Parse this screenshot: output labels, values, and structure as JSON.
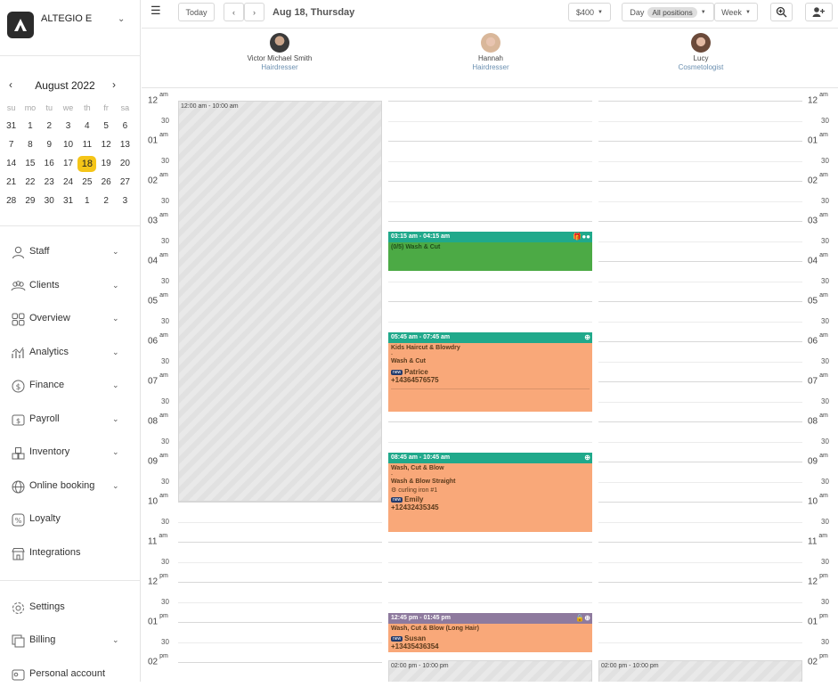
{
  "brand": {
    "name": "ALTEGIO E"
  },
  "calendar": {
    "month": "August 2022",
    "weekdays": [
      "su",
      "mo",
      "tu",
      "we",
      "th",
      "fr",
      "sa"
    ],
    "weeks": [
      [
        "31",
        "1",
        "2",
        "3",
        "4",
        "5",
        "6"
      ],
      [
        "7",
        "8",
        "9",
        "10",
        "11",
        "12",
        "13"
      ],
      [
        "14",
        "15",
        "16",
        "17",
        "18",
        "19",
        "20"
      ],
      [
        "21",
        "22",
        "23",
        "24",
        "25",
        "26",
        "27"
      ],
      [
        "28",
        "29",
        "30",
        "31",
        "1",
        "2",
        "3"
      ]
    ],
    "selected": "18"
  },
  "nav": {
    "staff": "Staff",
    "clients": "Clients",
    "overview": "Overview",
    "analytics": "Analytics",
    "finance": "Finance",
    "payroll": "Payroll",
    "inventory": "Inventory",
    "online_booking": "Online booking",
    "loyalty": "Loyalty",
    "integrations": "Integrations",
    "settings": "Settings",
    "billing": "Billing",
    "personal_account": "Personal account"
  },
  "toolbar": {
    "today": "Today",
    "date": "Aug 18, Thursday",
    "amount": "$400",
    "day": "Day",
    "positions": "All positions",
    "week": "Week"
  },
  "staff": [
    {
      "name": "Victor Michael Smith",
      "role": "Hairdresser"
    },
    {
      "name": "Hannah",
      "role": "Hairdresser"
    },
    {
      "name": "Lucy",
      "role": "Cosmetologist"
    }
  ],
  "timeline": {
    "hours": [
      {
        "h": "12",
        "ap": "am"
      },
      {
        "h": "01",
        "ap": "am"
      },
      {
        "h": "02",
        "ap": "am"
      },
      {
        "h": "03",
        "ap": "am"
      },
      {
        "h": "04",
        "ap": "am"
      },
      {
        "h": "05",
        "ap": "am"
      },
      {
        "h": "06",
        "ap": "am"
      },
      {
        "h": "07",
        "ap": "am"
      },
      {
        "h": "08",
        "ap": "am"
      },
      {
        "h": "09",
        "ap": "am"
      },
      {
        "h": "10",
        "ap": "am"
      },
      {
        "h": "11",
        "ap": "am"
      },
      {
        "h": "12",
        "ap": "pm"
      },
      {
        "h": "01",
        "ap": "pm"
      },
      {
        "h": "02",
        "ap": "pm"
      }
    ],
    "half_label": "30"
  },
  "blocks": {
    "victor_morning": "12:00 am - 10:00 am",
    "hannah_afternoon": "02:00 pm - 10:00 pm",
    "lucy_afternoon": "02:00 pm - 10:00 pm"
  },
  "appointments": {
    "a1": {
      "time": "03:15 am - 04:15 am",
      "service": "(0/5) Wash & Cut",
      "colors": {
        "head": "#20a98b",
        "body": "#4caa45"
      }
    },
    "a2": {
      "time": "05:45 am - 07:45 am",
      "service1": "Kids Haircut & Blowdry",
      "service2": "Wash & Cut",
      "badge": "new",
      "client": "Patrice",
      "phone": "+14364576575",
      "colors": {
        "head": "#20a98b",
        "body": "#f9a879"
      }
    },
    "a3": {
      "time": "08:45 am - 10:45 am",
      "service1": "Wash, Cut & Blow",
      "service2": "Wash & Blow Straight",
      "resource": "curling iron #1",
      "badge": "new",
      "client": "Emily",
      "phone": "+12432435345",
      "colors": {
        "head": "#20a98b",
        "body": "#f9a879"
      }
    },
    "a4": {
      "time": "12:45 pm - 01:45 pm",
      "service1": "Wash, Cut & Blow (Long Hair)",
      "badge": "new",
      "client": "Susan",
      "phone": "+13435436354",
      "colors": {
        "head": "#8e7a9e",
        "body": "#f9a879"
      }
    }
  }
}
